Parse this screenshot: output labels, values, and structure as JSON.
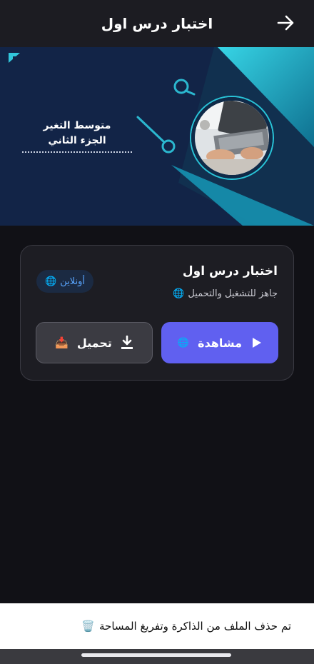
{
  "header": {
    "title": "اختبار درس اول",
    "back_icon": "arrow-right-icon"
  },
  "banner": {
    "line1": "متوسط التغير",
    "line2": "الجزء الثاني",
    "photo_icon": "laptop-photo"
  },
  "card": {
    "title": "اختبار درس اول",
    "subtitle": "جاهز للتشغيل والتحميل",
    "badge": "أونلاين",
    "watch_label": "مشاهدة",
    "download_label": "تحميل",
    "accent": "#6060f0"
  },
  "toast": {
    "message": "تم حذف الملف من الذاكرة وتفريغ المساحة"
  }
}
